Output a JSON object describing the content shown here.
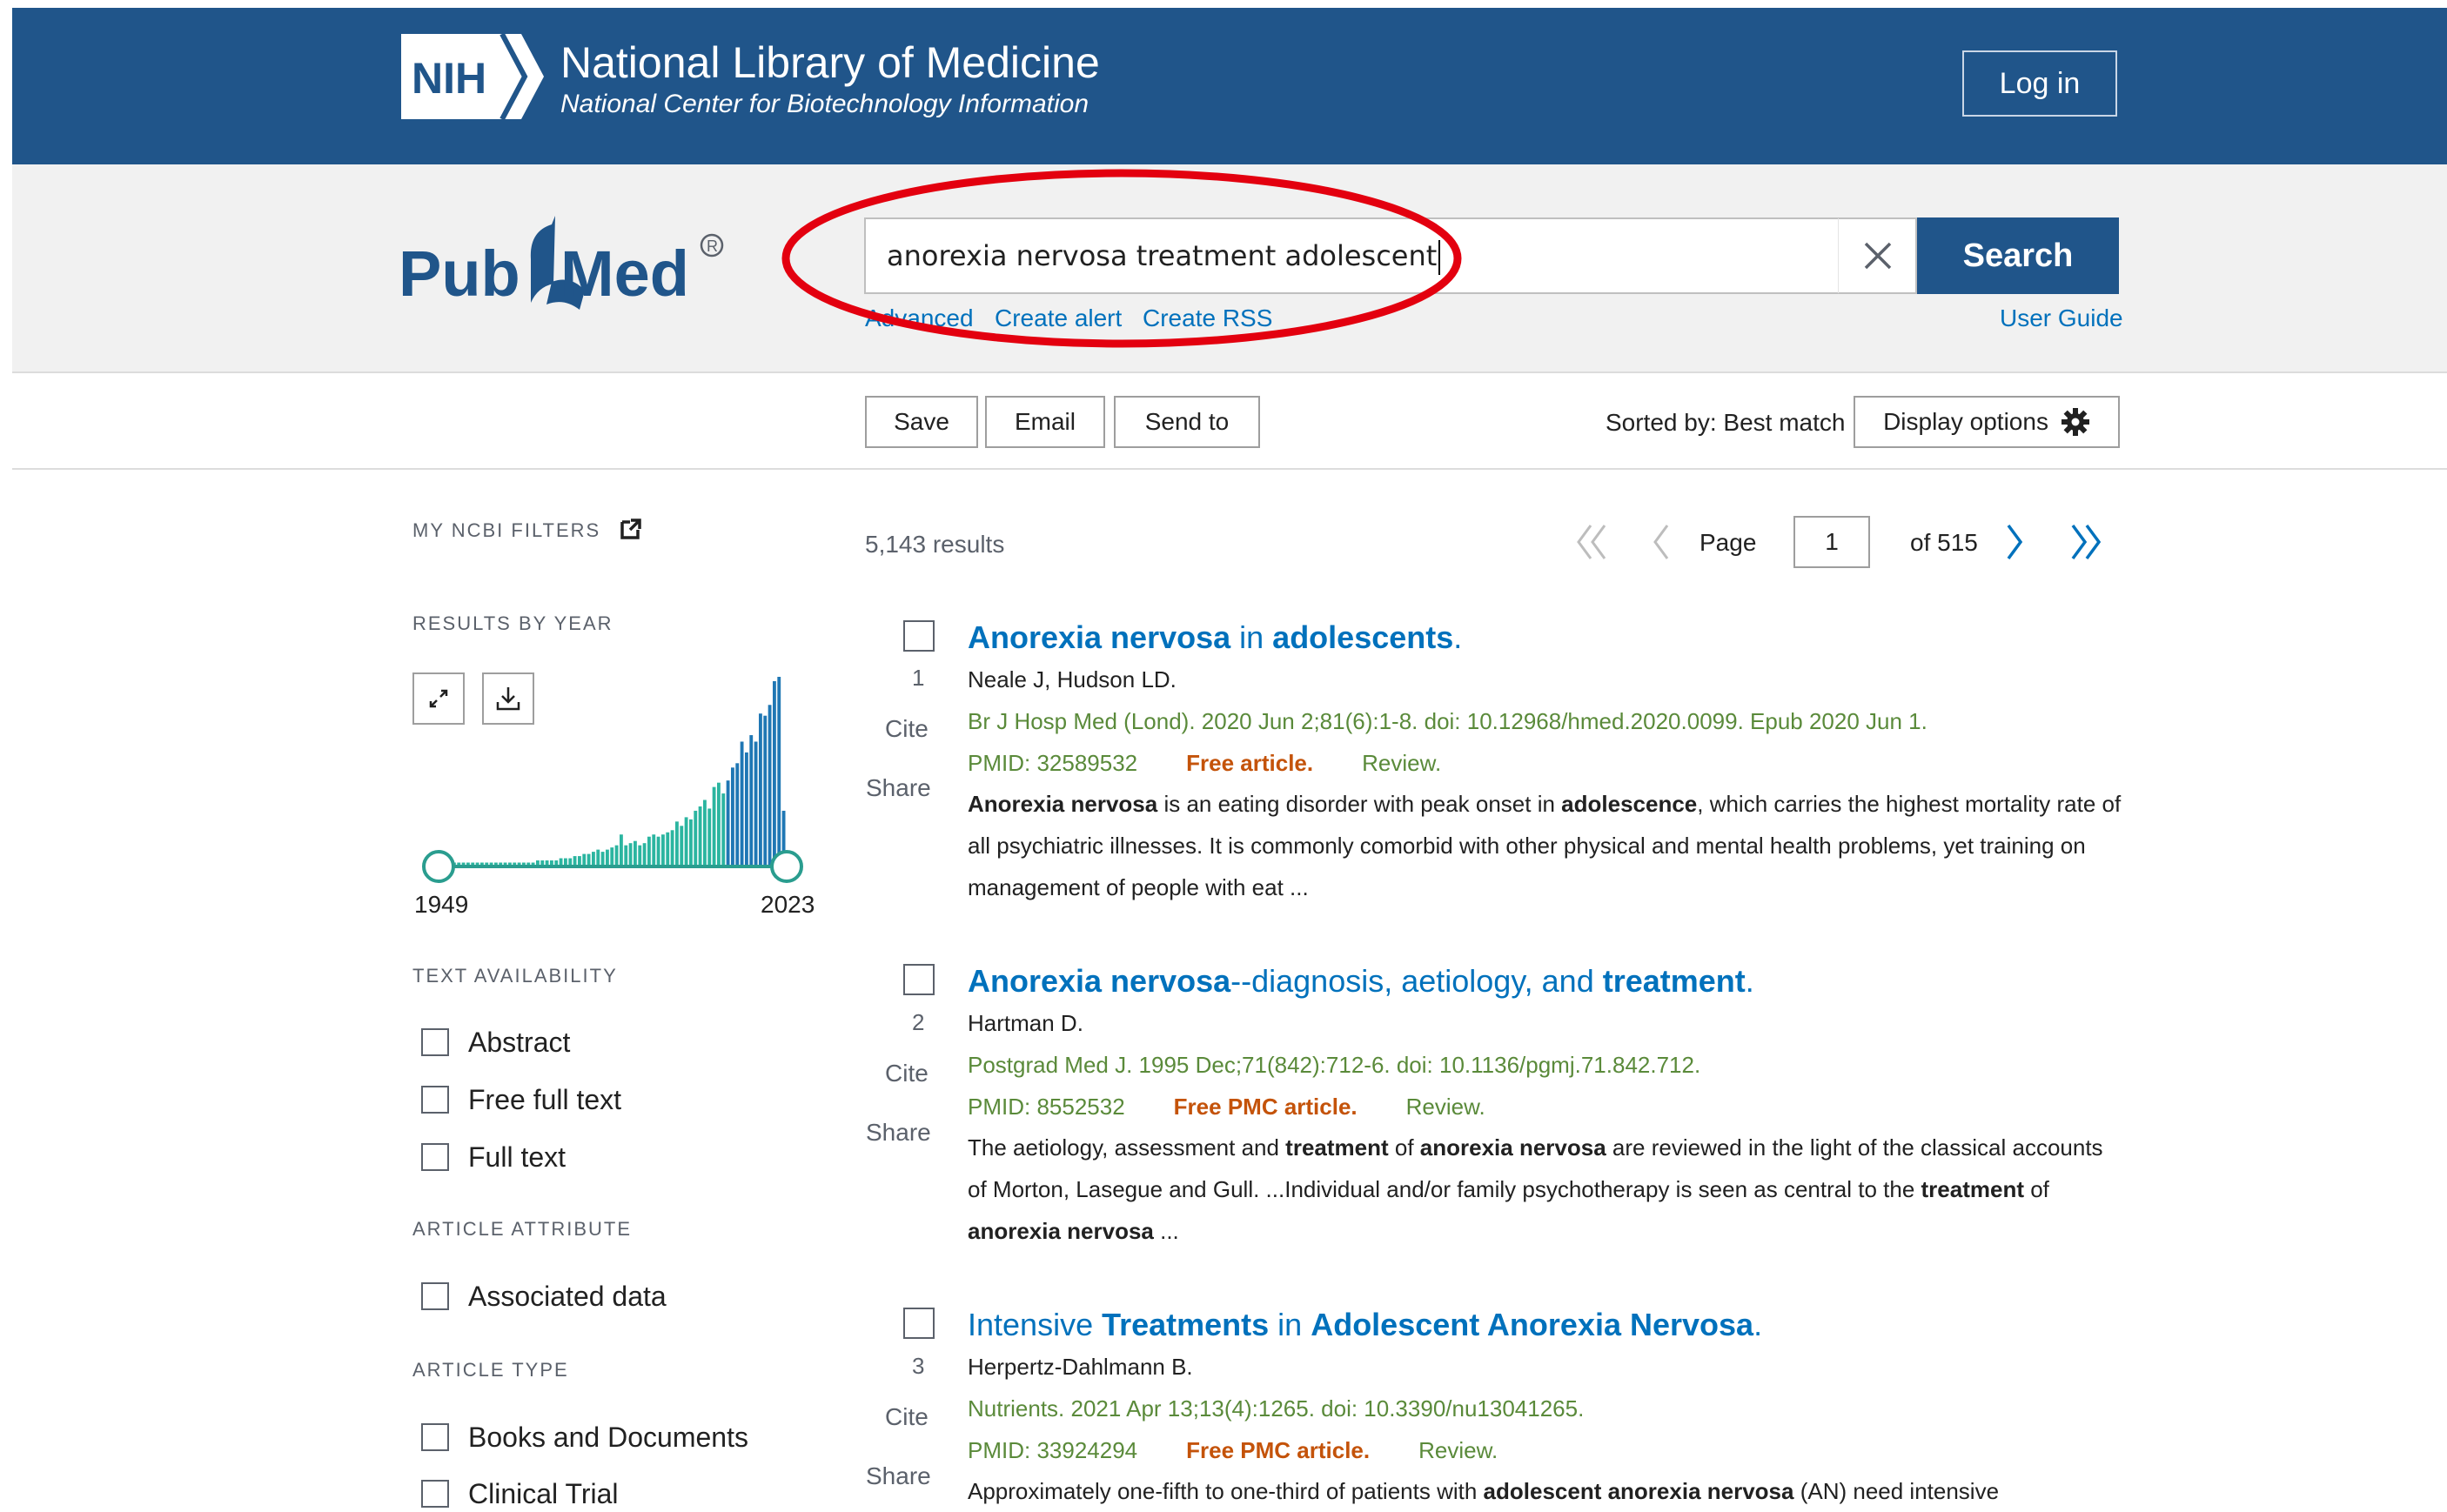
{
  "header": {
    "nih_badge": "NIH",
    "title": "National Library of Medicine",
    "subtitle": "National Center for Biotechnology Information",
    "login_label": "Log in"
  },
  "search": {
    "logo_text": "PubMed",
    "query": "anorexia nervosa treatment adolescent",
    "search_label": "Search",
    "links": [
      "Advanced",
      "Create alert",
      "Create RSS"
    ],
    "user_guide": "User Guide"
  },
  "toolbar": {
    "save_label": "Save",
    "email_label": "Email",
    "send_to_label": "Send to",
    "sorted_label": "Sorted by: Best match",
    "display_options_label": "Display options"
  },
  "sidebar": {
    "my_ncbi_filters": "MY NCBI FILTERS",
    "results_by_year": "RESULTS BY YEAR",
    "year_start": "1949",
    "year_end": "2023",
    "text_availability": "TEXT AVAILABILITY",
    "text_filters": [
      "Abstract",
      "Free full text",
      "Full text"
    ],
    "article_attribute": "ARTICLE ATTRIBUTE",
    "attribute_filters": [
      "Associated data"
    ],
    "article_type": "ARTICLE TYPE",
    "type_filters": [
      "Books and Documents",
      "Clinical Trial"
    ]
  },
  "results_header": {
    "count": "5,143 results",
    "page_label": "Page",
    "page_value": "1",
    "of_label": "of 515"
  },
  "results": [
    {
      "number": "1",
      "title_segments": [
        {
          "text": "Anorexia nervosa",
          "bold": true
        },
        {
          "text": " in ",
          "bold": false
        },
        {
          "text": "adolescents",
          "bold": true
        },
        {
          "text": ".",
          "bold": false
        }
      ],
      "authors": "Neale J, Hudson LD.",
      "citation": "Br J Hosp Med (Lond). 2020 Jun 2;81(6):1-8. doi: 10.12968/hmed.2020.0099. Epub 2020 Jun 1.",
      "pmid": "PMID: 32589532",
      "free": "Free article.",
      "type": "Review.",
      "snippet_segments": [
        {
          "text": "Anorexia nervosa",
          "bold": true
        },
        {
          "text": " is an eating disorder with peak onset in ",
          "bold": false
        },
        {
          "text": "adolescence",
          "bold": true
        },
        {
          "text": ", which carries the highest mortality rate of all psychiatric illnesses. It is commonly comorbid with other physical and mental health problems, yet training on management of people with eat ...",
          "bold": false
        }
      ],
      "cite": "Cite",
      "share": "Share"
    },
    {
      "number": "2",
      "title_segments": [
        {
          "text": "Anorexia nervosa",
          "bold": true
        },
        {
          "text": "--diagnosis, aetiology, and ",
          "bold": false
        },
        {
          "text": "treatment",
          "bold": true
        },
        {
          "text": ".",
          "bold": false
        }
      ],
      "authors": "Hartman D.",
      "citation": "Postgrad Med J. 1995 Dec;71(842):712-6. doi: 10.1136/pgmj.71.842.712.",
      "pmid": "PMID: 8552532",
      "free": "Free PMC article.",
      "type": "Review.",
      "snippet_segments": [
        {
          "text": "The aetiology, assessment and ",
          "bold": false
        },
        {
          "text": "treatment",
          "bold": true
        },
        {
          "text": " of ",
          "bold": false
        },
        {
          "text": "anorexia nervosa",
          "bold": true
        },
        {
          "text": " are reviewed in the light of the classical accounts of Morton, Lasegue and Gull. ...Individual and/or family psychotherapy is seen as central to the ",
          "bold": false
        },
        {
          "text": "treatment",
          "bold": true
        },
        {
          "text": " of ",
          "bold": false
        },
        {
          "text": "anorexia nervosa",
          "bold": true
        },
        {
          "text": " ...",
          "bold": false
        }
      ],
      "cite": "Cite",
      "share": "Share"
    },
    {
      "number": "3",
      "title_segments": [
        {
          "text": "Intensive ",
          "bold": false
        },
        {
          "text": "Treatments",
          "bold": true
        },
        {
          "text": " in ",
          "bold": false
        },
        {
          "text": "Adolescent Anorexia Nervosa",
          "bold": true
        },
        {
          "text": ".",
          "bold": false
        }
      ],
      "authors": "Herpertz-Dahlmann B.",
      "citation": "Nutrients. 2021 Apr 13;13(4):1265. doi: 10.3390/nu13041265.",
      "pmid": "PMID: 33924294",
      "free": "Free PMC article.",
      "type": "Review.",
      "snippet_segments": [
        {
          "text": "Approximately one-fifth to one-third of patients with ",
          "bold": false
        },
        {
          "text": "adolescent anorexia nervosa",
          "bold": true
        },
        {
          "text": " (AN) need intensive",
          "bold": false
        }
      ],
      "cite": "Cite",
      "share": "Share"
    }
  ],
  "year_histogram": {
    "type": "bar",
    "start_year": 1949,
    "end_year": 2023,
    "counts_relative": [
      1,
      1,
      1,
      1,
      1,
      1,
      1,
      1,
      1,
      1,
      1,
      1,
      1,
      1,
      1,
      1,
      1,
      1,
      1,
      1,
      1,
      2,
      2,
      2,
      2,
      2,
      3,
      3,
      3,
      4,
      4,
      5,
      5,
      6,
      7,
      6,
      7,
      8,
      9,
      14,
      9,
      10,
      11,
      9,
      10,
      13,
      14,
      13,
      14,
      15,
      16,
      20,
      18,
      22,
      21,
      25,
      27,
      30,
      26,
      36,
      38,
      33,
      39,
      45,
      47,
      57,
      52,
      60,
      57,
      70,
      69,
      74,
      85,
      87,
      25
    ],
    "colors": {
      "start": "#2bb5a0",
      "end": "#1f77b4"
    }
  },
  "colors": {
    "header_bg": "#20558a",
    "link": "#0071bc",
    "free_article": "#c4530a",
    "citation_green": "#5a8a3a",
    "annotation_red": "#e3000f"
  }
}
